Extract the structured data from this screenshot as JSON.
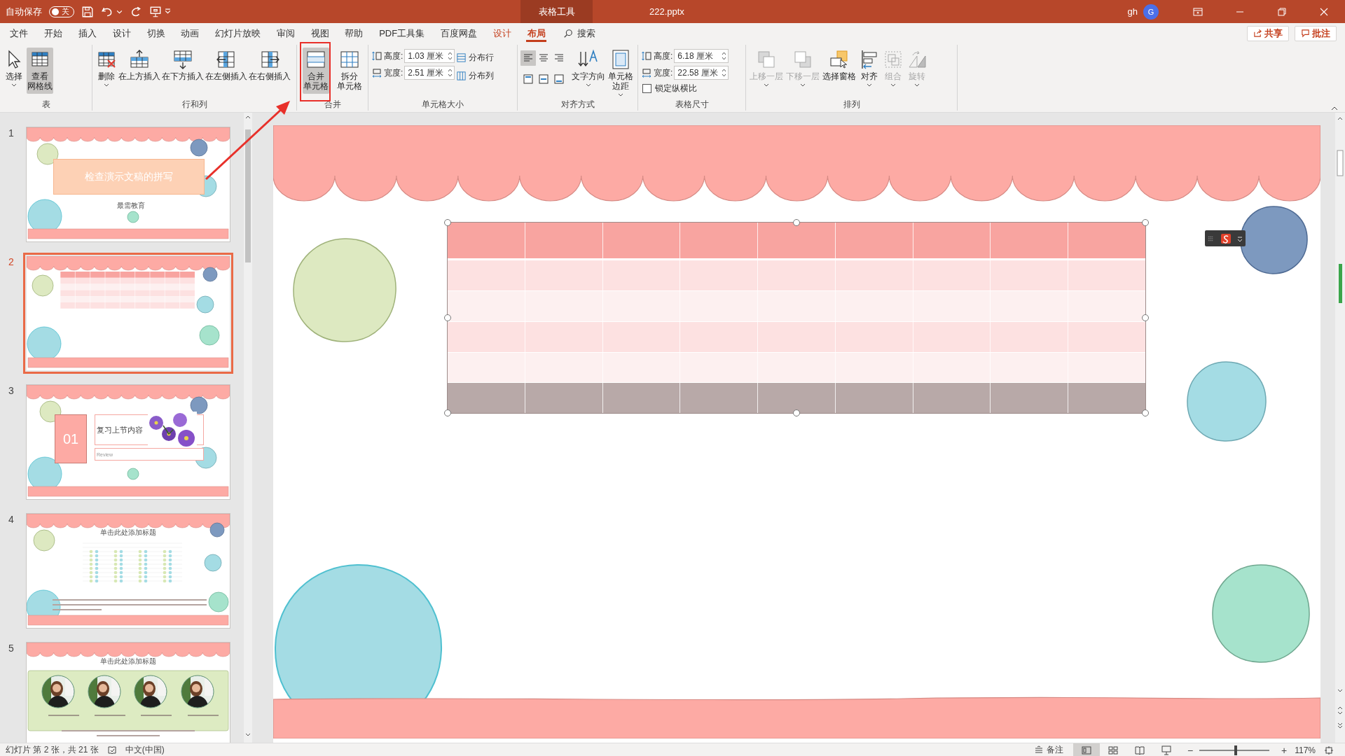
{
  "title_bar": {
    "autosave_label": "自动保存",
    "autosave_toggle": {
      "label": "关",
      "on": false
    },
    "context_label": "表格工具",
    "file_name": "222.pptx",
    "user": "gh",
    "avatar": "G"
  },
  "tabs": [
    {
      "label": "文件",
      "kind": "normal",
      "selected": false
    },
    {
      "label": "开始",
      "kind": "normal",
      "selected": false
    },
    {
      "label": "插入",
      "kind": "normal",
      "selected": false
    },
    {
      "label": "设计",
      "kind": "normal",
      "selected": false
    },
    {
      "label": "切换",
      "kind": "normal",
      "selected": false
    },
    {
      "label": "动画",
      "kind": "normal",
      "selected": false
    },
    {
      "label": "幻灯片放映",
      "kind": "normal",
      "selected": false
    },
    {
      "label": "审阅",
      "kind": "normal",
      "selected": false
    },
    {
      "label": "视图",
      "kind": "normal",
      "selected": false
    },
    {
      "label": "帮助",
      "kind": "normal",
      "selected": false
    },
    {
      "label": "PDF工具集",
      "kind": "normal",
      "selected": false
    },
    {
      "label": "百度网盘",
      "kind": "normal",
      "selected": false
    },
    {
      "label": "设计",
      "kind": "context",
      "selected": false
    },
    {
      "label": "布局",
      "kind": "context",
      "selected": true
    }
  ],
  "search": {
    "placeholder": "搜索"
  },
  "share_button": "共享",
  "comment_button": "批注",
  "ribbon": {
    "groups": [
      {
        "label": "表",
        "items": [
          {
            "kind": "large",
            "lines": [
              "选择"
            ],
            "pressed": false,
            "disabled": false,
            "dropdown": true
          },
          {
            "kind": "large",
            "lines": [
              "查看",
              "网格线"
            ],
            "pressed": true,
            "disabled": false,
            "dropdown": false
          }
        ]
      },
      {
        "label": "行和列",
        "items": [
          {
            "kind": "large",
            "lines": [
              "删除"
            ],
            "pressed": false,
            "disabled": false,
            "dropdown": true
          },
          {
            "kind": "large",
            "lines": [
              "在上方插入"
            ],
            "pressed": false,
            "disabled": false,
            "dropdown": false
          },
          {
            "kind": "large",
            "lines": [
              "在下方插入"
            ],
            "pressed": false,
            "disabled": false,
            "dropdown": false
          },
          {
            "kind": "large",
            "lines": [
              "在左侧插入"
            ],
            "pressed": false,
            "disabled": false,
            "dropdown": false
          },
          {
            "kind": "large",
            "lines": [
              "在右侧插入"
            ],
            "pressed": false,
            "disabled": false,
            "dropdown": false
          }
        ]
      },
      {
        "label": "合并",
        "items": [
          {
            "kind": "large",
            "lines": [
              "合并",
              "单元格"
            ],
            "pressed": true,
            "disabled": false,
            "dropdown": false
          },
          {
            "kind": "large",
            "lines": [
              "拆分",
              "单元格"
            ],
            "pressed": false,
            "disabled": false,
            "dropdown": false
          }
        ]
      },
      {
        "label": "单元格大小",
        "items": [
          {
            "kind": "spin_set",
            "fields": [
              {
                "label": "高度:",
                "value": "1.03 厘米"
              },
              {
                "label": "宽度:",
                "value": "2.51 厘米"
              }
            ]
          },
          {
            "kind": "small_set",
            "buttons": [
              {
                "label": "分布行"
              },
              {
                "label": "分布列"
              }
            ]
          }
        ]
      },
      {
        "label": "对齐方式",
        "items": [
          {
            "kind": "align_set",
            "buttons": [
              {
                "pressed": true
              },
              {
                "pressed": false
              },
              {
                "pressed": false
              },
              {
                "pressed": false
              },
              {
                "pressed": false
              },
              {
                "pressed": false
              }
            ]
          },
          {
            "kind": "large",
            "lines": [
              "文字方向"
            ],
            "pressed": false,
            "disabled": false,
            "dropdown": true
          },
          {
            "kind": "large",
            "lines": [
              "单元格",
              "边距"
            ],
            "pressed": false,
            "disabled": false,
            "dropdown": true
          }
        ]
      },
      {
        "label": "表格尺寸",
        "items": [
          {
            "kind": "spin_set",
            "fields": [
              {
                "label": "高度:",
                "value": "6.18 厘米"
              },
              {
                "label": "宽度:",
                "value": "22.58 厘米"
              }
            ],
            "checkbox": {
              "label": "锁定纵横比",
              "checked": false
            }
          }
        ]
      },
      {
        "label": "排列",
        "items": [
          {
            "kind": "large",
            "lines": [
              "上移一层"
            ],
            "pressed": false,
            "disabled": true,
            "dropdown": true
          },
          {
            "kind": "large",
            "lines": [
              "下移一层"
            ],
            "pressed": false,
            "disabled": true,
            "dropdown": true
          },
          {
            "kind": "large",
            "lines": [
              "选择窗格"
            ],
            "pressed": false,
            "disabled": false,
            "dropdown": false
          },
          {
            "kind": "large",
            "lines": [
              "对齐"
            ],
            "pressed": false,
            "disabled": false,
            "dropdown": true
          },
          {
            "kind": "large",
            "lines": [
              "组合"
            ],
            "pressed": false,
            "disabled": true,
            "dropdown": true
          },
          {
            "kind": "large",
            "lines": [
              "旋转"
            ],
            "pressed": false,
            "disabled": true,
            "dropdown": true
          }
        ]
      }
    ]
  },
  "slides": [
    {
      "number": "1",
      "kind": "title",
      "selected": false,
      "title": "检查演示文稿的拼写",
      "subtitle": "最需教育"
    },
    {
      "number": "2",
      "kind": "table",
      "selected": true
    },
    {
      "number": "3",
      "kind": "section",
      "selected": false,
      "badge": "01",
      "title": "复习上节内容",
      "subtitle": "Review"
    },
    {
      "number": "4",
      "kind": "chart",
      "selected": false,
      "title": "单击此处添加标题"
    },
    {
      "number": "5",
      "kind": "photos",
      "selected": false,
      "title": "单击此处添加标题"
    }
  ],
  "slide": {
    "table_selected": true
  },
  "status_bar": {
    "slide_info": "幻灯片 第 2 张，共 21 张",
    "language": "中文(中国)",
    "notes": "备注",
    "views": [
      {
        "selected": true
      },
      {
        "selected": false
      },
      {
        "selected": false
      },
      {
        "selected": false
      }
    ],
    "zoom": {
      "minus": "−",
      "plus": "+",
      "level": 0.52,
      "reading": "117%"
    }
  }
}
